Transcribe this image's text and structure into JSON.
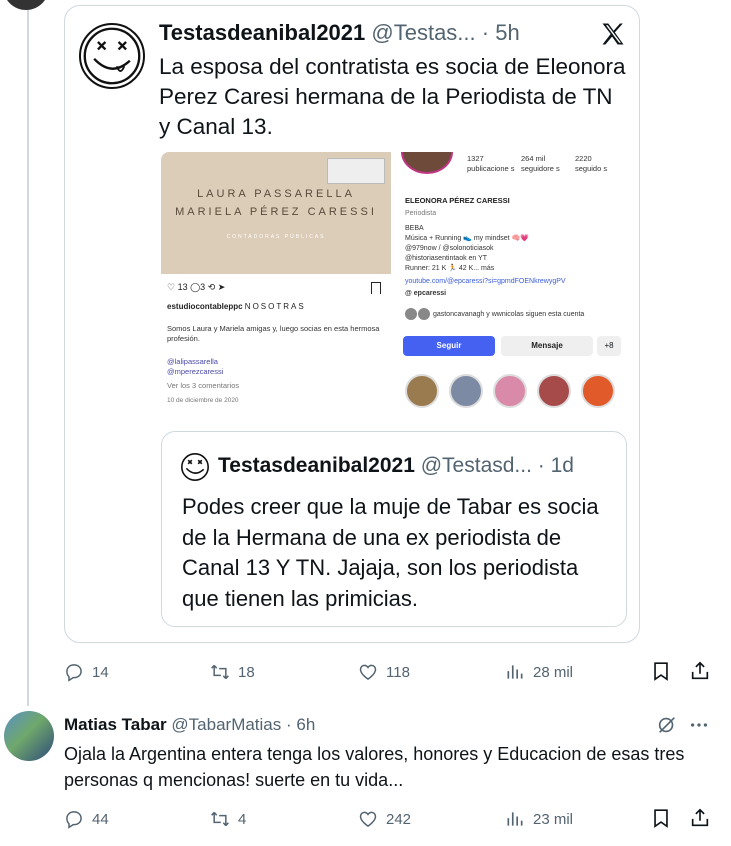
{
  "embedded_tweet": {
    "name": "Testasdeanibal2021",
    "handle": "@Testas...",
    "time": "· 5h",
    "text": "La esposa del contratista es socia de Eleonora Perez Caresi hermana de la Periodista de TN y Canal 13."
  },
  "media_left": {
    "banner_line1": "LAURA PASSARELLA",
    "banner_line2": "MARIELA PÉREZ CARESSI",
    "banner_line3": "CONTADORAS PÚBLICAS",
    "likes": "13",
    "comments": "3",
    "username": "estudiocontableppc",
    "username_suffix": "NOSOTRAS",
    "caption": "Somos Laura y Mariela amigas y, luego socias en esta hermosa profesión.",
    "tag1": "@lalipassarella",
    "tag2": "@mperezcaressi",
    "view_comments": "Ver los 3 comentarios",
    "date": "10 de diciembre de 2020"
  },
  "media_right": {
    "stat1_value": "1327",
    "stat1_label": "publicacione s",
    "stat2_value": "264 mil",
    "stat2_label": "seguidore s",
    "stat3_value": "2220",
    "stat3_label": "seguido s",
    "profile_name": "ELEONORA PÉREZ CARESSI",
    "role": "Periodista",
    "bio1": "BEBA",
    "bio2": "Música + Running 👟 my mindset 🧠💗",
    "bio3": "@979now / @solonoticiasok",
    "bio4": "@historiasentintaok en YT",
    "bio5": "Runner: 21 K 🏃 42 K... más",
    "link": "youtube.com/@epcaressi?si=gpmdFOENkrewygPV",
    "threads": "epcaressi",
    "followed_by": "gastoncavanagh y wwnicolas siguen esta cuenta",
    "follow_btn": "Seguir",
    "message_btn": "Mensaje",
    "add_btn": "+8"
  },
  "quoted_tweet": {
    "name": "Testasdeanibal2021",
    "handle": "@Testasd...",
    "time": "· 1d",
    "text": "Podes creer que la muje de Tabar es socia de la Hermana de una ex periodista de Canal 13 Y TN. Jajaja, son los periodista que tienen las primicias."
  },
  "main_actions": {
    "replies": "14",
    "reposts": "18",
    "likes": "118",
    "views": "28 mil"
  },
  "reply": {
    "name": "Matias Tabar",
    "handle": "@TabarMatias",
    "time": "· 6h",
    "text": "Ojala la Argentina entera tenga los valores, honores y Educacion  de esas tres personas q mencionas! suerte en tu vida..."
  },
  "reply_actions": {
    "replies": "44",
    "reposts": "4",
    "likes": "242",
    "views": "23 mil"
  },
  "colors": {
    "text": "#0f1419",
    "secondary": "#536471",
    "border": "#cfd9de",
    "ig_blue": "#4461f2"
  }
}
